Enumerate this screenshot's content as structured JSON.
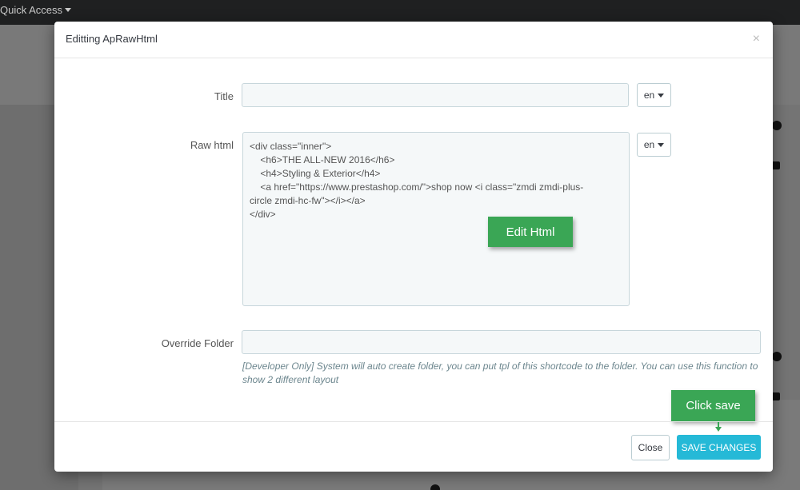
{
  "background": {
    "quick_access_label": "Quick Access"
  },
  "modal": {
    "title": "Editting ApRawHtml",
    "close_symbol": "×",
    "fields": {
      "title_label": "Title",
      "title_value": "",
      "title_lang": "en",
      "raw_html_label": "Raw html",
      "raw_html_lang": "en",
      "raw_html_lines": [
        "<div class=\"inner\">",
        "    <h6>THE ALL-NEW 2016</h6>",
        "    <h4>Styling & Exterior</h4>",
        "    <a href=\"https://www.prestashop.com/\">shop now <i class=\"zmdi zmdi-plus-",
        "circle zmdi-hc-fw\"></i></a>",
        "</div>"
      ],
      "override_folder_label": "Override Folder",
      "override_folder_value": "",
      "override_folder_hint": "[Developer Only] System will auto create folder, you can put tpl of this shortcode to the folder. You can use this function to show 2 different layout"
    },
    "footer": {
      "close_label": "Close",
      "save_label": "SAVE CHANGES"
    }
  },
  "annotations": {
    "edit_html_label": "Edit Html",
    "click_save_label": "Click save",
    "color": "#3aa655"
  }
}
